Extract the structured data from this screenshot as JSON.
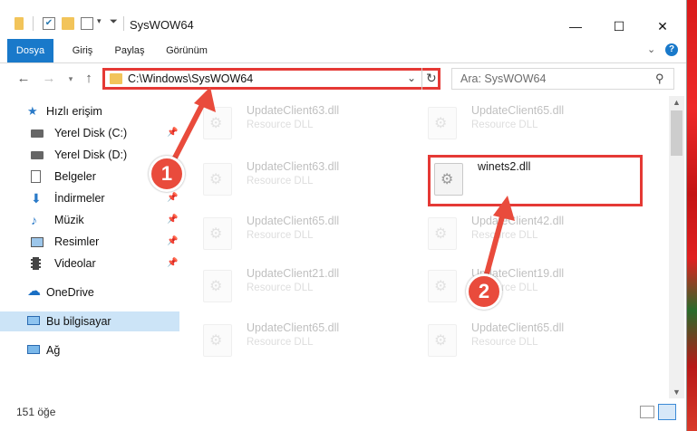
{
  "window": {
    "title": "SysWOW64",
    "controls": {
      "minimize": "—",
      "maximize": "☐",
      "close": "✕"
    }
  },
  "ribbon": {
    "tabs": [
      "Dosya",
      "Giriş",
      "Paylaş",
      "Görünüm"
    ],
    "collapse_icon": "chevron-down-icon",
    "help_icon": "help-icon"
  },
  "address": {
    "path": "C:\\Windows\\SysWOW64",
    "search_placeholder": "Ara: SysWOW64"
  },
  "nav": {
    "quick_access": "Hızlı erişim",
    "items": [
      {
        "label": "Yerel Disk (C:)",
        "icon": "drive-icon",
        "pinned": true
      },
      {
        "label": "Yerel Disk (D:)",
        "icon": "drive-icon",
        "pinned": false
      },
      {
        "label": "Belgeler",
        "icon": "documents-icon",
        "pinned": true
      },
      {
        "label": "İndirmeler",
        "icon": "download-icon",
        "pinned": true
      },
      {
        "label": "Müzik",
        "icon": "music-icon",
        "pinned": true
      },
      {
        "label": "Resimler",
        "icon": "pictures-icon",
        "pinned": true
      },
      {
        "label": "Videolar",
        "icon": "video-icon",
        "pinned": true
      }
    ],
    "onedrive": "OneDrive",
    "this_pc": "Bu bilgisayar",
    "network": "Ağ"
  },
  "files": [
    {
      "name": "UpdateClient63.dll",
      "type": "Resource DLL"
    },
    {
      "name": "UpdateClient65.dll",
      "type": "Resource DLL"
    },
    {
      "name": "UpdateClient63.dll",
      "type": "Resource DLL"
    },
    {
      "name": "winets2.dll",
      "type": ""
    },
    {
      "name": "UpdateClient65.dll",
      "type": "Resource DLL"
    },
    {
      "name": "UpdateClient42.dll",
      "type": "Resource DLL"
    },
    {
      "name": "UpdateClient21.dll",
      "type": "Resource DLL"
    },
    {
      "name": "UpdateClient19.dll",
      "type": "Resource DLL"
    },
    {
      "name": "UpdateClient65.dll",
      "type": "Resource DLL"
    },
    {
      "name": "UpdateClient65.dll",
      "type": "Resource DLL"
    }
  ],
  "status": {
    "count": "151 öğe"
  },
  "annotations": {
    "step1": "1",
    "step2": "2",
    "color": "#e94b3c"
  }
}
